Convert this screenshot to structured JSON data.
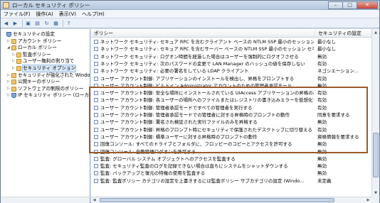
{
  "window": {
    "title": "ローカル セキュリティ ポリシー"
  },
  "window_buttons": {
    "minimize": "–",
    "maximize": "□",
    "close": "✕"
  },
  "menu": [
    "ファイル(F)",
    "操作(A)",
    "表示(V)",
    "ヘルプ(H)"
  ],
  "toolbar": [
    "back-icon",
    "forward-icon",
    "up-icon",
    "show-hide-tree-icon",
    "refresh-icon",
    "export-icon",
    "help-icon"
  ],
  "tree": {
    "items": [
      {
        "label": "セキュリティの設定",
        "level": 0,
        "icon": "shield",
        "expander": ""
      },
      {
        "label": "アカウント ポリシー",
        "level": 1,
        "icon": "folder",
        "expander": "▷"
      },
      {
        "label": "ローカル ポリシー",
        "level": 1,
        "icon": "folder",
        "expander": "◢"
      },
      {
        "label": "監査ポリシー",
        "level": 2,
        "icon": "folder",
        "expander": "▷"
      },
      {
        "label": "ユーザー権利の割り当て",
        "level": 2,
        "icon": "folder",
        "expander": "▷"
      },
      {
        "label": "セキュリティ オプション",
        "level": 2,
        "icon": "folder",
        "expander": "▷"
      },
      {
        "label": "セキュリティが強化された Windows",
        "level": 1,
        "icon": "folder",
        "expander": "▷"
      },
      {
        "label": "公開キーのポリシー",
        "level": 1,
        "icon": "folder",
        "expander": "▷"
      },
      {
        "label": "ソフトウェアの制限のポリシー",
        "level": 1,
        "icon": "folder",
        "expander": "▷"
      },
      {
        "label": "IP セキュリティ ポリシー (ローカル",
        "level": 1,
        "icon": "shield",
        "expander": "▷"
      }
    ],
    "selected_index": 5
  },
  "list": {
    "columns": [
      "ポリシー",
      "セキュリティの設定"
    ],
    "rows": [
      {
        "name": "ネットワーク セキュリティ: セキュア RPC を含むクライアント ベースの NTLM SSP 最小のセッション セキ...",
        "value": "最小なし"
      },
      {
        "name": "ネットワーク セキュリティ: セキュア RPC を含むサーバー ベースの NTLM SSP 最小のセッション セキュ...",
        "value": "最小なし"
      },
      {
        "name": "ネットワーク セキュリティ: ログオン時間を経過した場合はユーザーを強制的にログオフさせる",
        "value": "無効"
      },
      {
        "name": "ネットワーク セキュリティ: 次のパスワードの変更で LAN Manager のハッシュの値を保存しない",
        "value": "有効"
      },
      {
        "name": "ネットワーク セキュリティ: 必要の署名をしている LDAP クライアント",
        "value": "ネゴシエーション..."
      },
      {
        "name": "ユーザー アカウント制御: アプリケーションのインストールを検出し、昇格をプロンプトする",
        "value": "有効"
      },
      {
        "name": "ユーザー アカウント制御: ビルトイン Administrator アカウントのための管理者承認モード",
        "value": "無効"
      },
      {
        "name": "ユーザー アカウント制御: 安全な場所にインストールされている UIAccess アプリケーションの昇格のみ",
        "value": "有効"
      },
      {
        "name": "ユーザー アカウント制御: 各ユーザーの場所へのファイルまたはレジストリの書き込みエラーを仮想化する",
        "value": "有効"
      },
      {
        "name": "ユーザー アカウント制御: 管理者承認モードですべての管理者を実行する",
        "value": "有効"
      },
      {
        "name": "ユーザー アカウント制御: 管理者承認モードでの管理者に対する昇格時のプロンプトの動作",
        "value": "同意を要求する"
      },
      {
        "name": "ユーザー アカウント制御: 署名され検証された実行ファイルのみを昇格する",
        "value": "無効"
      },
      {
        "name": "ユーザー アカウント制御: 昇格のプロンプト時にセキュリティで保護されたデスクトップに切り替える",
        "value": "有効"
      },
      {
        "name": "ユーザー アカウント制御: 標準ユーザーに対する昇格時のプロンプトの動作",
        "value": "資格情報を要求する"
      },
      {
        "name": "回復コンソール: すべてのドライブとフォルダに、フロッピーのコピーとアクセスを許可する",
        "value": "無効"
      },
      {
        "name": "回復コンソール: 自動管理ログオンを許可する",
        "value": "無効"
      },
      {
        "name": "監査: グローバル システム オブジェクトへのアクセスを監査する",
        "value": "無効"
      },
      {
        "name": "監査: セキュリティ監査のログを記録できない場合は直ちにシステムをシャットダウンする",
        "value": "無効"
      },
      {
        "name": "監査: バックアップと復元の特権の使用を監査する",
        "value": "無効"
      },
      {
        "name": "監査: 監査ポリシー カテゴリの設定を上書きするには監査ポリシー サブカテゴリの設定 (Windo...",
        "value": "未定義"
      }
    ]
  },
  "scroll": {
    "up": "▲",
    "down": "▼",
    "left": "◀",
    "right": "▶"
  }
}
